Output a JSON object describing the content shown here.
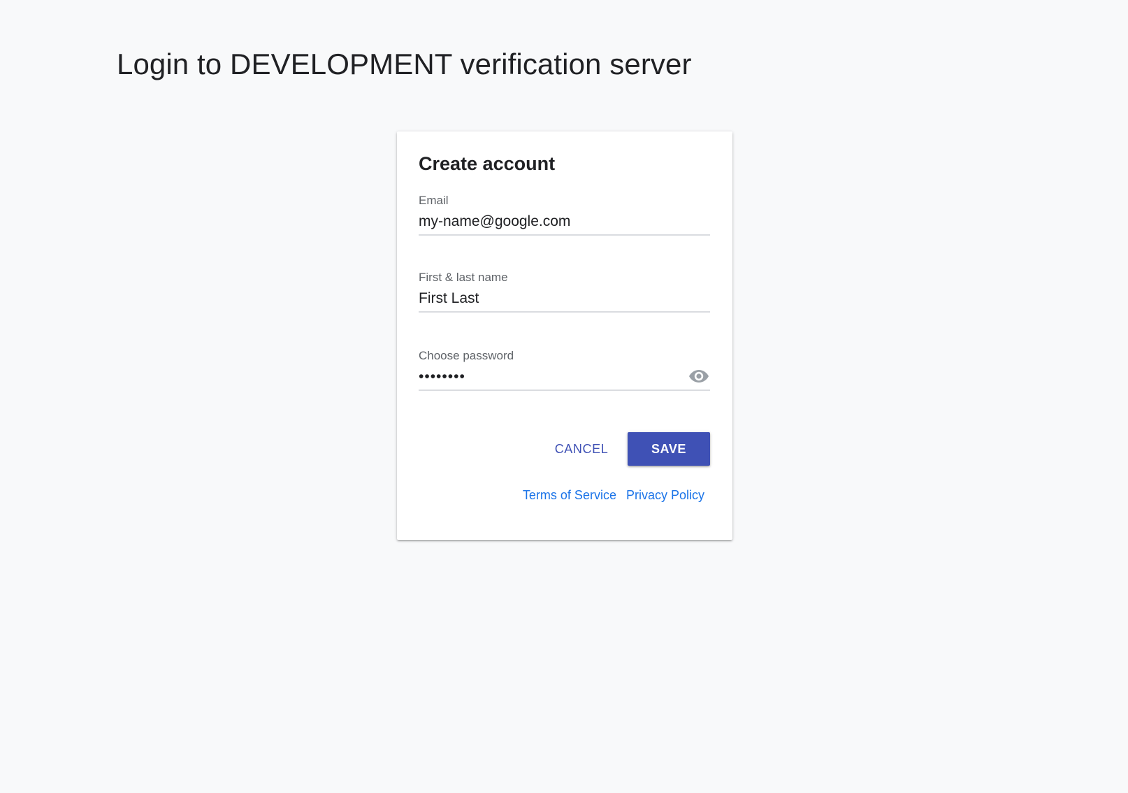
{
  "page": {
    "title": "Login to DEVELOPMENT verification server"
  },
  "form": {
    "title": "Create account",
    "email": {
      "label": "Email",
      "value": "my-name@google.com"
    },
    "name": {
      "label": "First & last name",
      "value": "First Last"
    },
    "password": {
      "label": "Choose password",
      "value": "••••••••",
      "toggle_icon": "eye-icon"
    },
    "actions": {
      "cancel_label": "CANCEL",
      "save_label": "SAVE"
    },
    "links": {
      "terms_label": "Terms of Service",
      "privacy_label": "Privacy Policy"
    }
  },
  "colors": {
    "background": "#f8f9fa",
    "primary": "#3f51b5",
    "link": "#1a73e8",
    "label": "#5f6368",
    "text": "#202124",
    "divider": "#dadce0"
  }
}
